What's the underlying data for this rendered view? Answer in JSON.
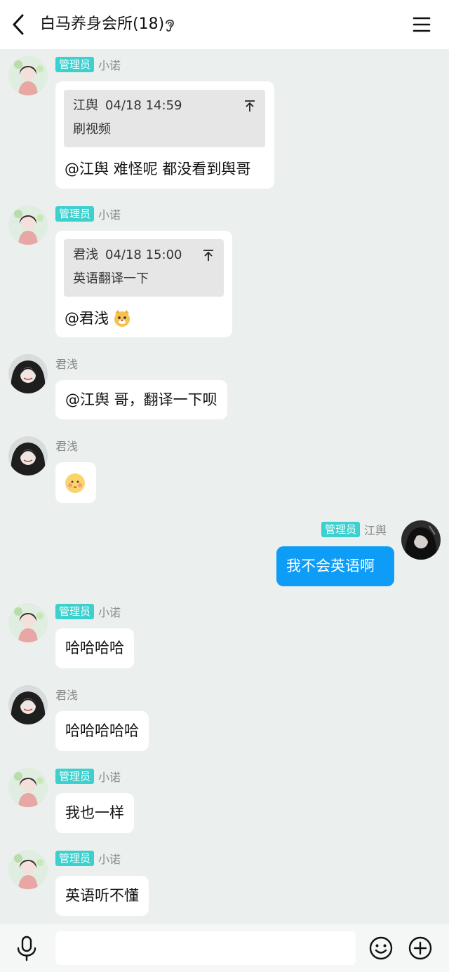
{
  "header": {
    "title": "白马养身会所(18)"
  },
  "messages": [
    {
      "sender": "小诺",
      "badge": "管理员",
      "quote": {
        "author": "江舆",
        "time": "04/18 14:59",
        "text": "刷视频"
      },
      "text": "@江舆 难怪呢 都没看到舆哥"
    },
    {
      "sender": "小诺",
      "badge": "管理员",
      "quote": {
        "author": "君浅",
        "time": "04/18 15:00",
        "text": "英语翻译一下"
      },
      "text": "@君浅"
    },
    {
      "sender": "君浅",
      "text": "@江舆 哥，翻译一下呗"
    },
    {
      "sender": "君浅"
    },
    {
      "sender": "江舆",
      "badge": "管理员",
      "text": "我不会英语啊"
    },
    {
      "sender": "小诺",
      "badge": "管理员",
      "text": "哈哈哈哈"
    },
    {
      "sender": "君浅",
      "text": "哈哈哈哈哈"
    },
    {
      "sender": "小诺",
      "badge": "管理员",
      "text": "我也一样"
    },
    {
      "sender": "小诺",
      "badge": "管理员",
      "text": "英语听不懂"
    }
  ],
  "input": {
    "placeholder": ""
  },
  "colors": {
    "accent_badge": "#3cd0cf",
    "self_bubble": "#0d9cf6",
    "background": "#ebefee"
  }
}
